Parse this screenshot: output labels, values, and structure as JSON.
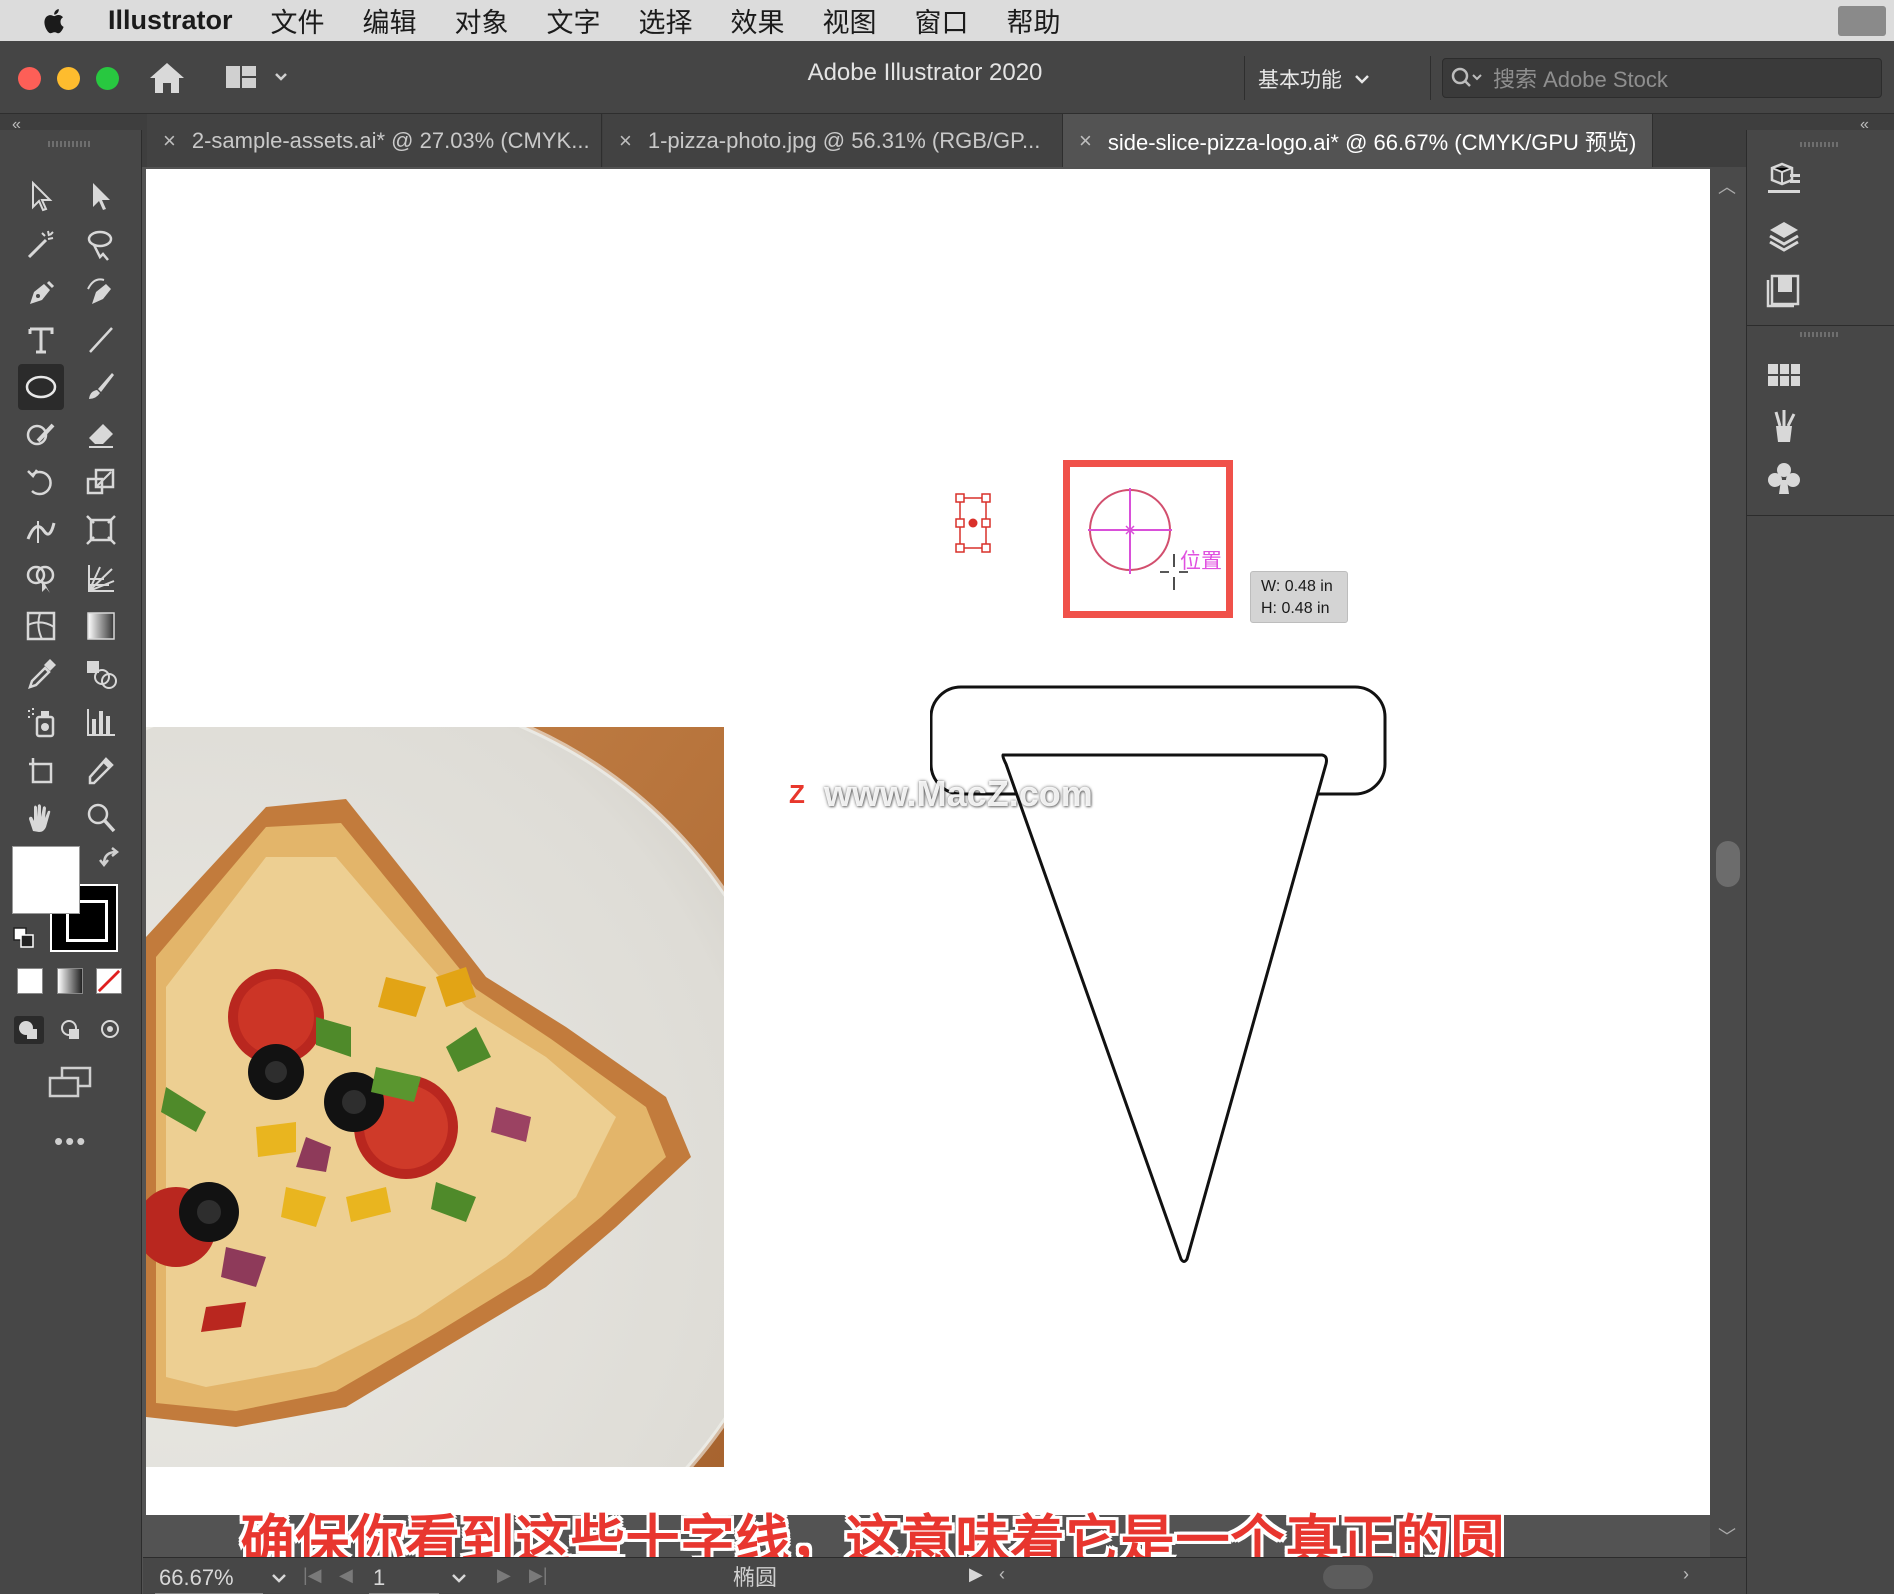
{
  "menubar": {
    "app_name": "Illustrator",
    "items": [
      "文件",
      "编辑",
      "对象",
      "文字",
      "选择",
      "效果",
      "视图",
      "窗口",
      "帮助"
    ]
  },
  "titlebar": {
    "title": "Adobe Illustrator 2020",
    "workspace": "基本功能",
    "stock_search_placeholder": "搜索 Adobe Stock"
  },
  "tabs": [
    {
      "label": "2-sample-assets.ai* @ 27.03% (CMYK...",
      "active": false
    },
    {
      "label": "1-pizza-photo.jpg @ 56.31% (RGB/GP...",
      "active": false
    },
    {
      "label": "side-slice-pizza-logo.ai* @ 66.67% (CMYK/GPU 预览)",
      "active": true
    }
  ],
  "toolbar": {
    "selected_tool": "ellipse-tool"
  },
  "canvas": {
    "smart_guide_label": "位置",
    "size_tooltip": {
      "w": "W: 0.48 in",
      "h": "H: 0.48 in"
    },
    "watermark_text": "www.MacZ.com",
    "watermark_logo": "Z",
    "highlight_color": "#f0514a",
    "guide_color": "#e050e0"
  },
  "subtitle": "确保你看到这些十字线，这意味着它是一个真正的圆",
  "statusbar": {
    "zoom": "66.67%",
    "page": "1",
    "current_tool": "椭圆"
  }
}
